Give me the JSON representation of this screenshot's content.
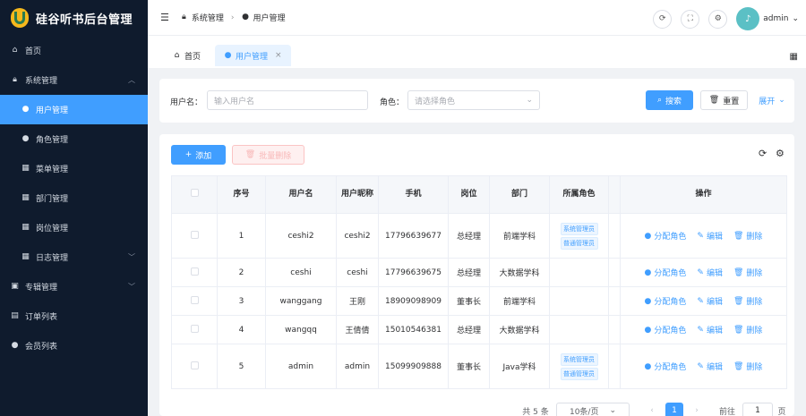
{
  "app": {
    "title": "硅谷听书后台管理"
  },
  "sidebar": {
    "items": [
      {
        "label": "首页",
        "icon": "home-icon"
      },
      {
        "label": "系统管理",
        "icon": "lock-icon"
      },
      {
        "label": "用户管理",
        "icon": "user-icon"
      },
      {
        "label": "角色管理",
        "icon": "user-icon"
      },
      {
        "label": "菜单管理",
        "icon": "grid-icon"
      },
      {
        "label": "部门管理",
        "icon": "grid-icon"
      },
      {
        "label": "岗位管理",
        "icon": "grid-icon"
      },
      {
        "label": "日志管理",
        "icon": "grid-icon"
      },
      {
        "label": "专辑管理",
        "icon": "album-icon"
      },
      {
        "label": "订单列表",
        "icon": "order-icon"
      },
      {
        "label": "会员列表",
        "icon": "user-icon"
      }
    ]
  },
  "header": {
    "breadcrumb": [
      "系统管理",
      "用户管理"
    ],
    "username": "admin"
  },
  "tabs": [
    {
      "label": "首页"
    },
    {
      "label": "用户管理"
    }
  ],
  "search": {
    "username_label": "用户名：",
    "username_placeholder": "输入用户名",
    "role_label": "角色：",
    "role_placeholder": "请选择角色",
    "search_button": "搜索",
    "reset_button": "重置",
    "expand_button": "展开"
  },
  "toolbar": {
    "add_button": "添加",
    "batch_delete_button": "批量删除"
  },
  "table": {
    "headers": [
      "序号",
      "用户名",
      "用户昵称",
      "手机",
      "岗位",
      "部门",
      "所属角色",
      "操作"
    ],
    "rows": [
      {
        "no": "1",
        "username": "ceshi2",
        "nickname": "ceshi2",
        "phone": "17796639677",
        "post": "总经理",
        "dept": "前端学科",
        "roles": [
          "系统管理员",
          "普通管理员"
        ]
      },
      {
        "no": "2",
        "username": "ceshi",
        "nickname": "ceshi",
        "phone": "17796639675",
        "post": "总经理",
        "dept": "大数据学科",
        "roles": []
      },
      {
        "no": "3",
        "username": "wanggang",
        "nickname": "王刚",
        "phone": "18909098909",
        "post": "董事长",
        "dept": "前端学科",
        "roles": []
      },
      {
        "no": "4",
        "username": "wangqq",
        "nickname": "王倩倩",
        "phone": "15010546381",
        "post": "总经理",
        "dept": "大数据学科",
        "roles": []
      },
      {
        "no": "5",
        "username": "admin",
        "nickname": "admin",
        "phone": "15099909888",
        "post": "董事长",
        "dept": "Java学科",
        "roles": [
          "系统管理员",
          "普通管理员"
        ]
      }
    ],
    "actions": {
      "assign_role": "分配角色",
      "edit": "编辑",
      "delete": "删除"
    }
  },
  "pagination": {
    "total": "共 5 条",
    "page_size": "10条/页",
    "current_page": "1",
    "goto_label": "前往",
    "goto_value": "1",
    "page_suffix": "页"
  },
  "colors": {
    "primary": "#409eff",
    "sidebar_bg": "#0f1b2d",
    "sidebar_active": "#409eff"
  }
}
